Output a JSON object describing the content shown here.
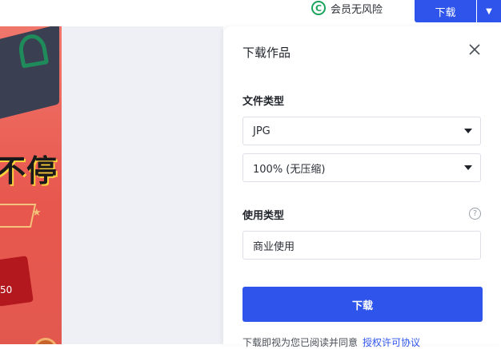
{
  "topbar": {
    "vip_text": "会员无风险",
    "vip_icon": "C",
    "download_label": "下载",
    "dropdown_caret": "▼"
  },
  "poster": {
    "headline": "不停",
    "price_fragment": "50"
  },
  "panel": {
    "title": "下载作品",
    "file_type_label": "文件类型",
    "format_value": "JPG",
    "quality_value": "100% (无压缩)",
    "usage_label": "使用类型",
    "usage_value": "商业使用",
    "help_icon": "?",
    "download_label": "下载",
    "footer_text": "下载即视为您已阅读并同意",
    "footer_link": "授权许可协议"
  },
  "colors": {
    "accent": "#2f54eb",
    "vip_green": "#1aa35a",
    "poster_red": "#e8574e"
  }
}
